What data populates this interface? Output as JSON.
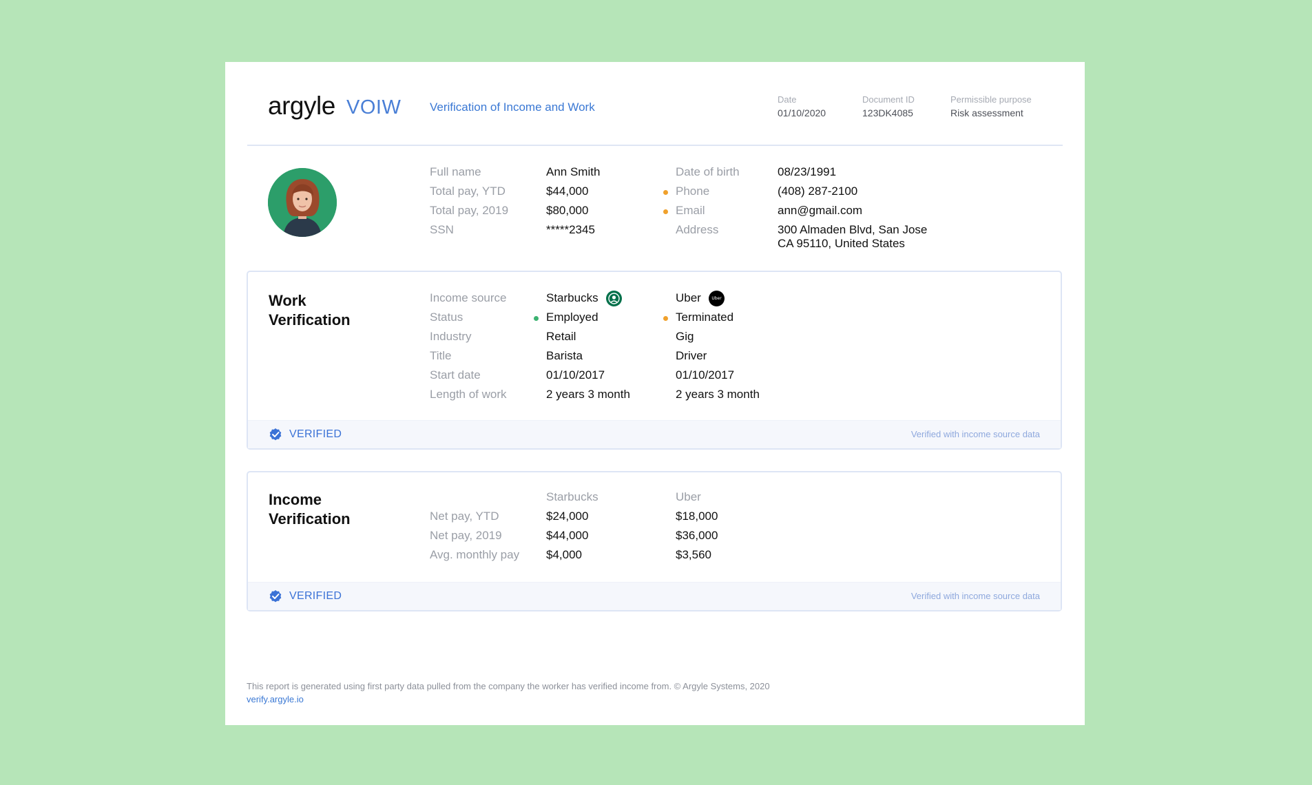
{
  "header": {
    "logo_wordmark": "argyle",
    "logo_product": "VOIW",
    "title": "Verification of Income and Work",
    "meta": [
      {
        "label": "Date",
        "value": "01/10/2020"
      },
      {
        "label": "Document ID",
        "value": "123DK4085"
      },
      {
        "label": "Permissible purpose",
        "value": "Risk assessment"
      }
    ]
  },
  "profile": {
    "left": [
      {
        "label": "Full name",
        "value": "Ann Smith"
      },
      {
        "label": "Total pay, YTD",
        "value": "$44,000"
      },
      {
        "label": "Total pay, 2019",
        "value": "$80,000"
      },
      {
        "label": "SSN",
        "value": "*****2345"
      }
    ],
    "right": [
      {
        "label": "Date of birth",
        "value": "08/23/1991"
      },
      {
        "label": "Phone",
        "value": "(408) 287-2100"
      },
      {
        "label": "Email",
        "value": "ann@gmail.com"
      },
      {
        "label": "Address",
        "value_line1": "300 Almaden Blvd, San Jose",
        "value_line2": "CA 95110, United States"
      }
    ],
    "colors": {
      "attention_dot": "#f0a12c",
      "avatar_bg": "#2c9e6a"
    }
  },
  "work": {
    "title_line1": "Work",
    "title_line2": "Verification",
    "labels": [
      "Income source",
      "Status",
      "Industry",
      "Title",
      "Start date",
      "Length of work"
    ],
    "sources": [
      {
        "name": "Starbucks",
        "icon": "starbucks-logo-icon",
        "status": "Employed",
        "status_color": "#3cb271",
        "industry": "Retail",
        "title": "Barista",
        "start_date": "01/10/2017",
        "length": "2 years 3 month"
      },
      {
        "name": "Uber",
        "icon": "uber-logo-icon",
        "icon_text": "Uber",
        "status": "Terminated",
        "status_color": "#f0a12c",
        "industry": "Gig",
        "title": "Driver",
        "start_date": "01/10/2017",
        "length": "2 years 3 month"
      }
    ],
    "verified_label": "VERIFIED",
    "verified_note": "Verified with income source data"
  },
  "income": {
    "title_line1": "Income",
    "title_line2": "Verification",
    "columns": [
      "Starbucks",
      "Uber"
    ],
    "rows": [
      {
        "label": "Net pay, YTD",
        "values": [
          "$24,000",
          "$18,000"
        ]
      },
      {
        "label": "Net pay, 2019",
        "values": [
          "$44,000",
          "$36,000"
        ]
      },
      {
        "label": "Avg. monthly pay",
        "values": [
          "$4,000",
          "$3,560"
        ]
      }
    ],
    "verified_label": "VERIFIED",
    "verified_note": "Verified with income source data"
  },
  "footer": {
    "disclaimer": "This report is generated using first party data pulled from the company the worker has verified income from. © Argyle Systems, 2020",
    "link": "verify.argyle.io"
  }
}
